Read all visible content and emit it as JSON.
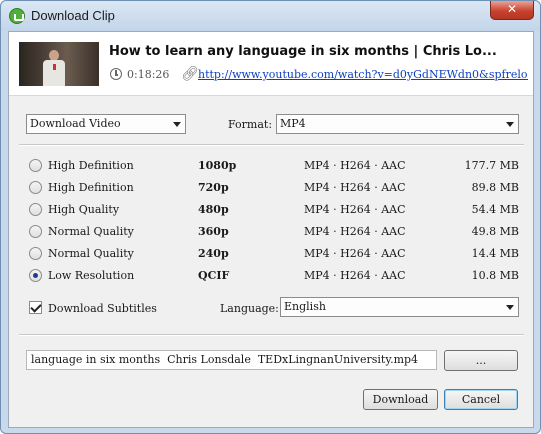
{
  "window": {
    "title": "Download Clip",
    "close_label": "✕"
  },
  "video": {
    "title": "How to learn any language in six months | Chris Lo...",
    "duration": "0:18:26",
    "url": "http://www.youtube.com/watch?v=d0yGdNEWdn0&spfrelo..."
  },
  "download_type": {
    "selected": "Download Video"
  },
  "format": {
    "label": "Format:",
    "selected": "MP4"
  },
  "quality_options": [
    {
      "quality": "High Definition",
      "resolution": "1080p",
      "codec": "MP4  ·  H264  ·  AAC",
      "size": "177.7 MB",
      "selected": false
    },
    {
      "quality": "High Definition",
      "resolution": "720p",
      "codec": "MP4  ·  H264  ·  AAC",
      "size": "89.8 MB",
      "selected": false
    },
    {
      "quality": "High Quality",
      "resolution": "480p",
      "codec": "MP4  ·  H264  ·  AAC",
      "size": "54.4 MB",
      "selected": false
    },
    {
      "quality": "Normal Quality",
      "resolution": "360p",
      "codec": "MP4  ·  H264  ·  AAC",
      "size": "49.8 MB",
      "selected": false
    },
    {
      "quality": "Normal Quality",
      "resolution": "240p",
      "codec": "MP4  ·  H264  ·  AAC",
      "size": "14.4 MB",
      "selected": false
    },
    {
      "quality": "Low Resolution",
      "resolution": "QCIF",
      "codec": "MP4  ·  H264  ·  AAC",
      "size": "10.8 MB",
      "selected": true
    }
  ],
  "subtitles": {
    "label": "Download Subtitles",
    "checked": true,
    "language_label": "Language:",
    "language": "English"
  },
  "file": {
    "name": "language in six months  Chris Lonsdale  TEDxLingnanUniversity.mp4",
    "browse_label": "..."
  },
  "actions": {
    "download_label": "Download",
    "cancel_label": "Cancel"
  },
  "colors": {
    "title_bar": "#c9d9ec",
    "close_button": "#c8432f",
    "link": "#0b3fbf",
    "dialog_background": "#f0f0f0"
  }
}
